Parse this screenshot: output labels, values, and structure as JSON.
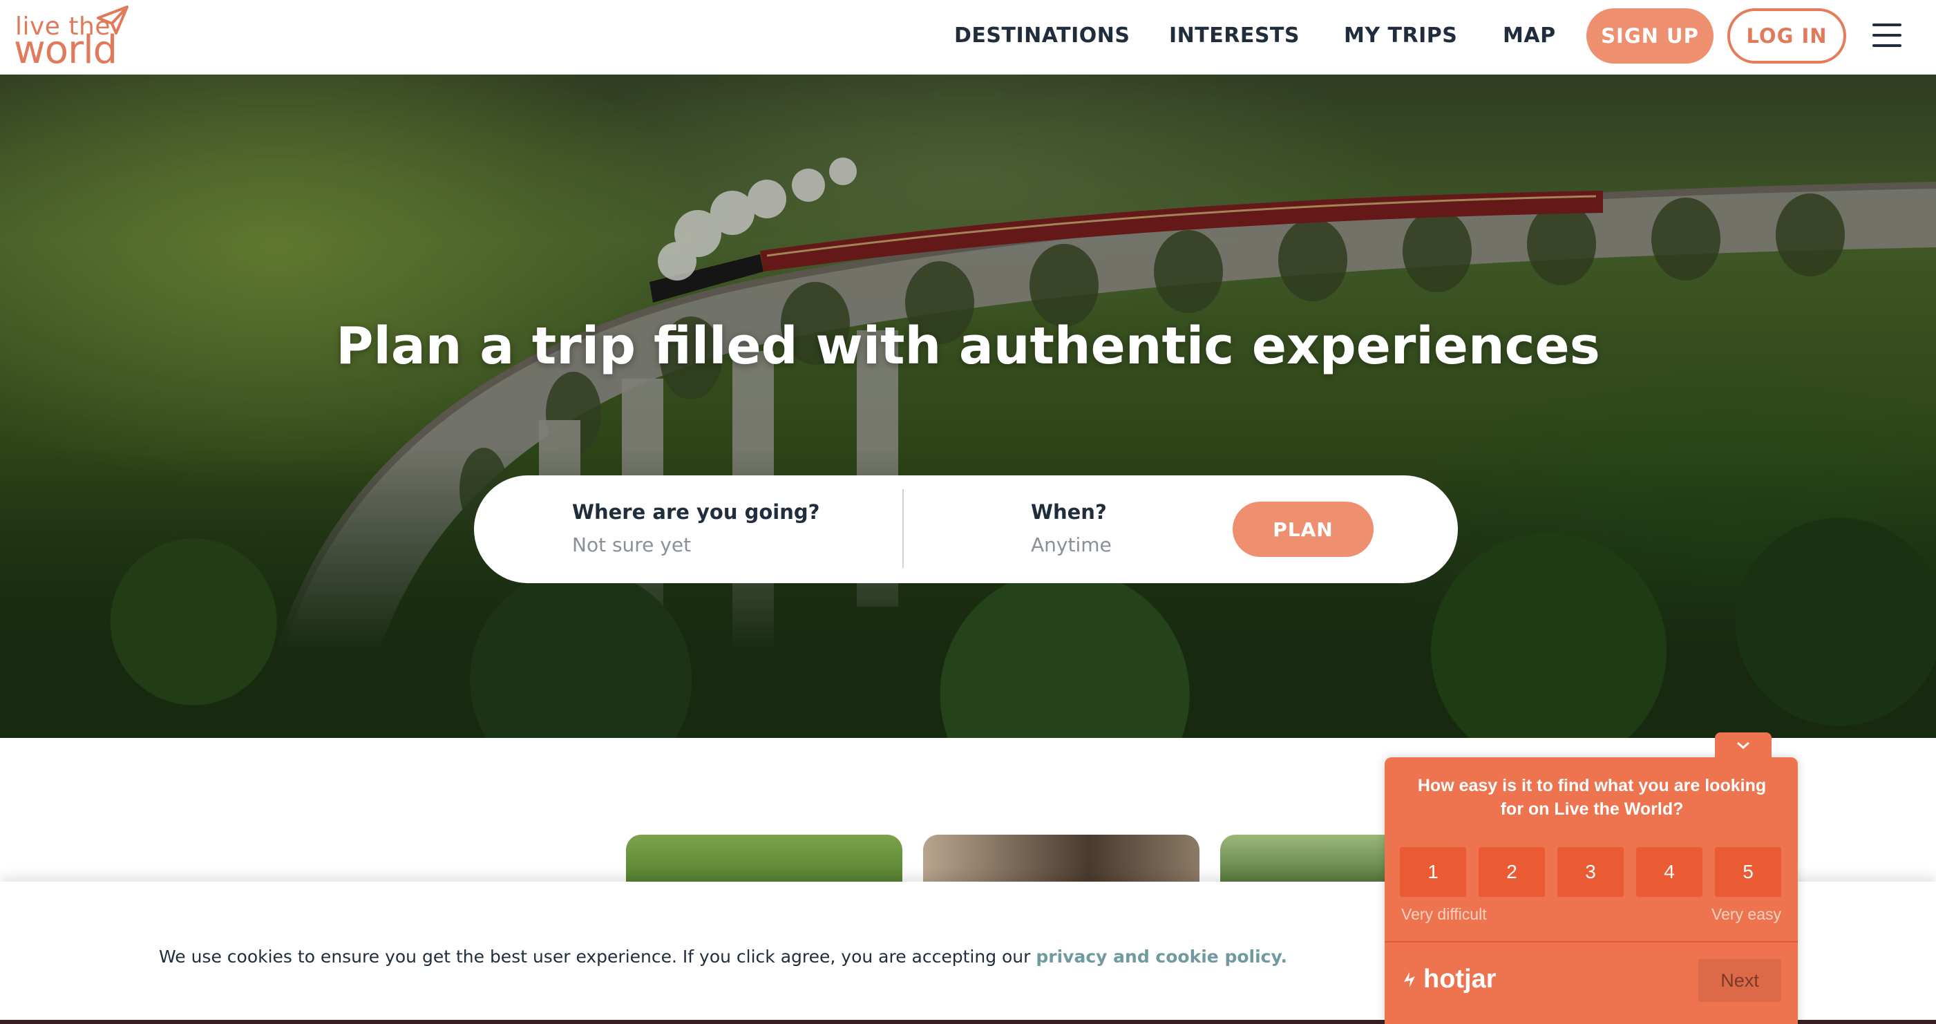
{
  "header": {
    "logo_line1": "live the",
    "logo_line2": "world",
    "nav": [
      "DESTINATIONS",
      "INTERESTS",
      "MY TRIPS",
      "MAP"
    ],
    "signup_label": "SIGN UP",
    "login_label": "LOG IN",
    "menu_icon": "hamburger-menu-icon"
  },
  "hero": {
    "title": "Plan a trip filled with authentic experiences",
    "search": {
      "where_label": "Where are you going?",
      "where_value": "Not sure yet",
      "when_label": "When?",
      "when_value": "Anytime",
      "plan_label": "PLAN"
    }
  },
  "cookie": {
    "text": "We use cookies to ensure you get the best user experience. If you click agree, you are accepting our ",
    "link": "privacy and cookie policy."
  },
  "hotjar": {
    "question": "How easy is it to find what you are looking for on Live the World?",
    "scale": [
      "1",
      "2",
      "3",
      "4",
      "5"
    ],
    "low_label": "Very difficult",
    "high_label": "Very easy",
    "brand": "hotjar",
    "next_label": "Next",
    "toggle_icon": "chevron-down-icon"
  },
  "colors": {
    "accent": "#ee8f6f",
    "accent_border": "#e67a59",
    "hotjar_bg": "#ee7450",
    "nav_text": "#1f2d3d"
  }
}
